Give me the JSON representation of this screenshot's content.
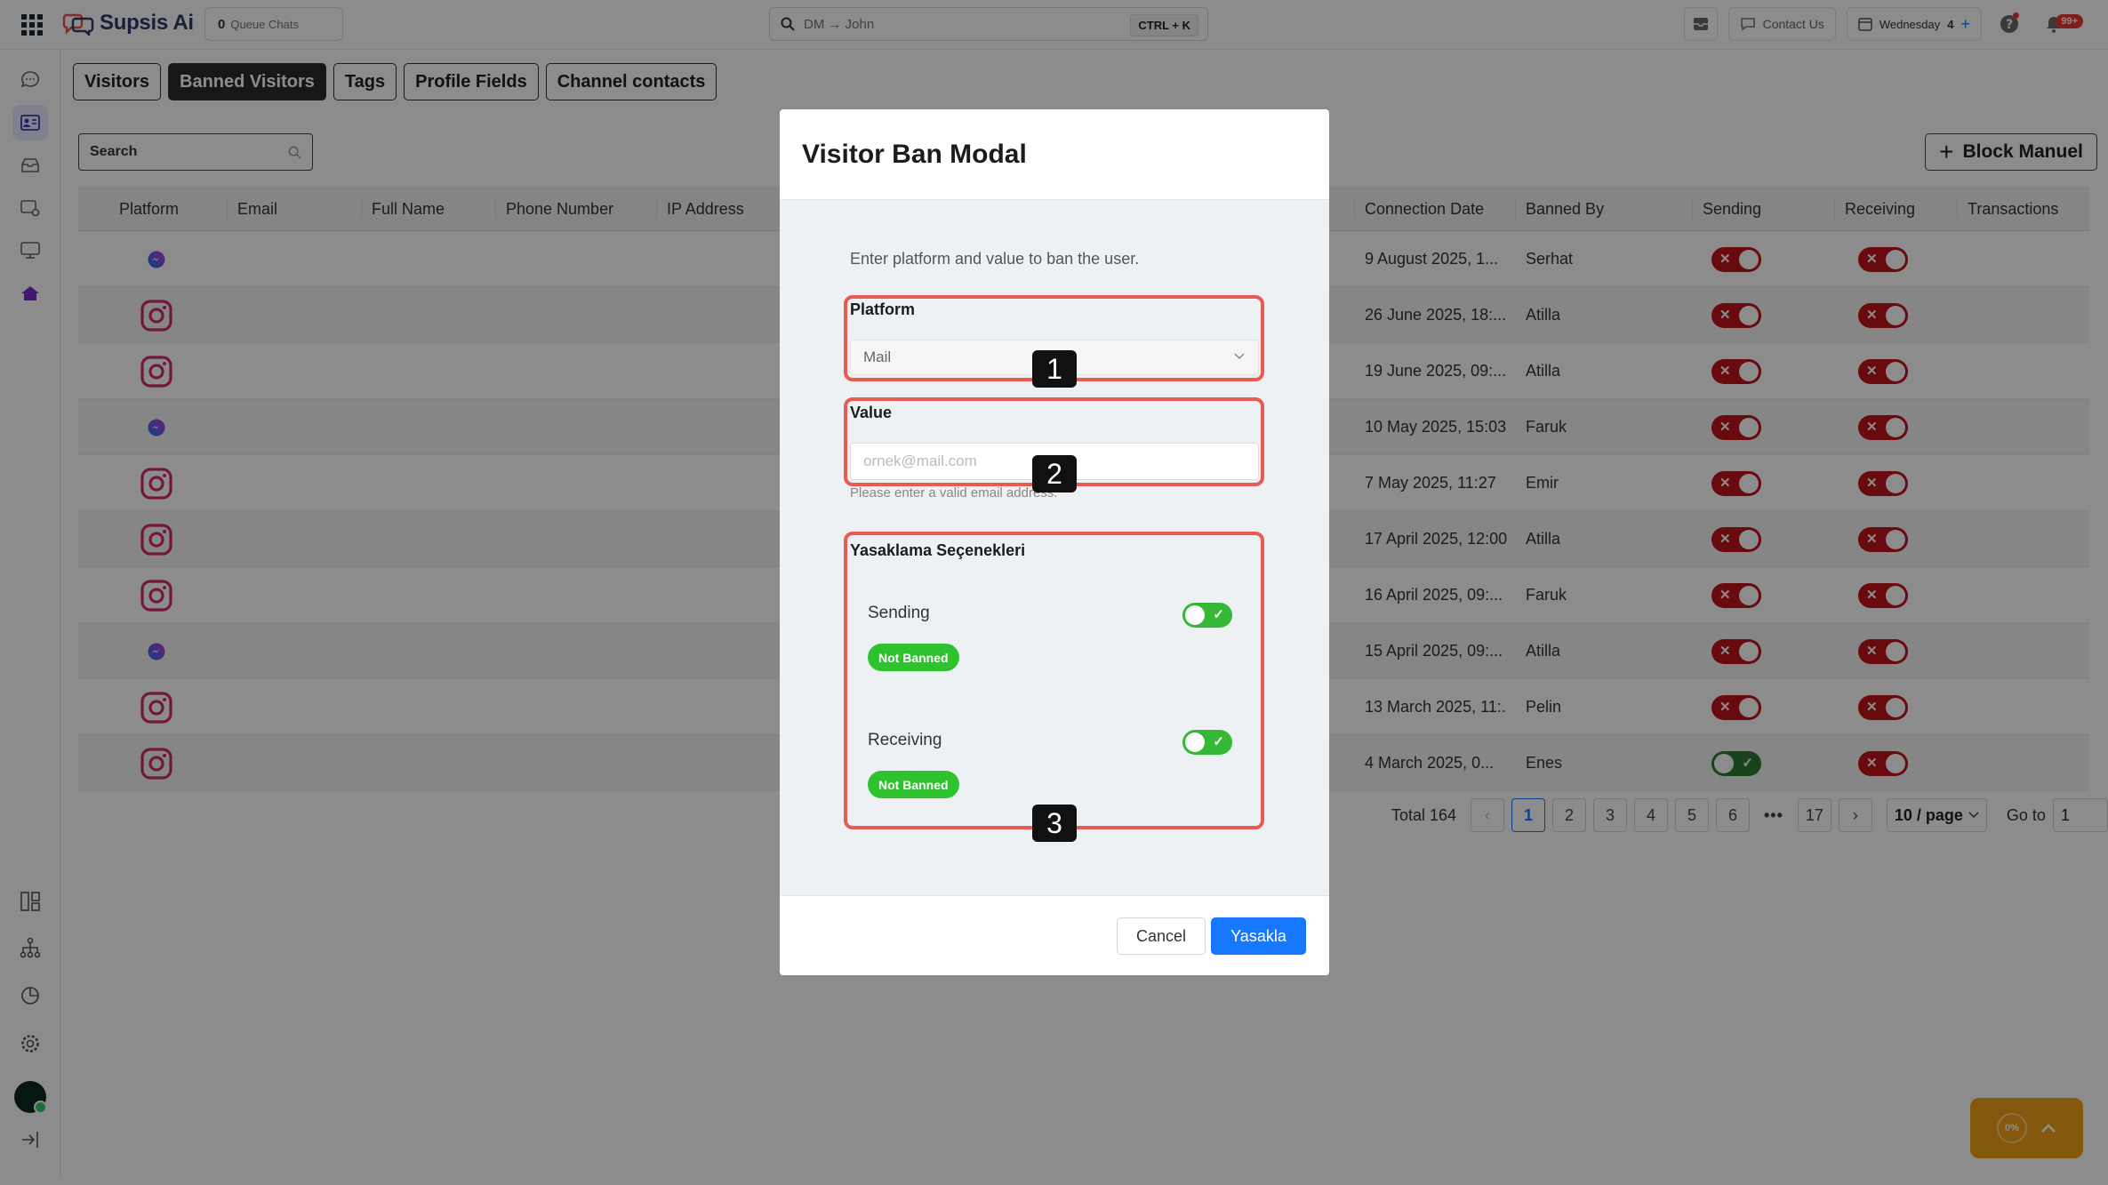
{
  "app": {
    "brand": "Supsis Ai",
    "queue": {
      "count": "0",
      "label": "Queue Chats"
    },
    "search": {
      "value": "DM → John",
      "shortcut": "CTRL + K"
    },
    "contact_us": "Contact Us",
    "day": {
      "label": "Wednesday",
      "count": "4"
    },
    "notifications_badge": "99+"
  },
  "tabs": [
    "Visitors",
    "Banned Visitors",
    "Tags",
    "Profile Fields",
    "Channel contacts"
  ],
  "table_search_label": "Search",
  "block_button_label": "Block Manuel",
  "columns": {
    "platform": "Platform",
    "email": "Email",
    "full_name": "Full Name",
    "phone": "Phone Number",
    "ip": "IP Address",
    "connection_date": "Connection Date",
    "banned_by": "Banned By",
    "sending": "Sending",
    "receiving": "Receiving",
    "transactions": "Transactions"
  },
  "rows": [
    {
      "platform": "messenger",
      "date": "9 August 2025, 1...",
      "by": "Serhat",
      "sending": "banned",
      "receiving": "banned"
    },
    {
      "platform": "instagram",
      "date": "26 June 2025, 18:...",
      "by": "Atilla",
      "sending": "banned",
      "receiving": "banned"
    },
    {
      "platform": "instagram",
      "date": "19 June 2025, 09:...",
      "by": "Atilla",
      "sending": "banned",
      "receiving": "banned"
    },
    {
      "platform": "messenger",
      "date": "10 May 2025, 15:03",
      "by": "Faruk",
      "sending": "banned",
      "receiving": "banned"
    },
    {
      "platform": "instagram",
      "date": "7 May 2025, 11:27",
      "by": "Emir",
      "sending": "banned",
      "receiving": "banned"
    },
    {
      "platform": "instagram",
      "date": "17 April 2025, 12:00",
      "by": "Atilla",
      "sending": "banned",
      "receiving": "banned"
    },
    {
      "platform": "instagram",
      "date": "16 April 2025, 09:...",
      "by": "Faruk",
      "sending": "banned",
      "receiving": "banned"
    },
    {
      "platform": "messenger",
      "date": "15 April 2025, 09:...",
      "by": "Atilla",
      "sending": "banned",
      "receiving": "banned"
    },
    {
      "platform": "instagram",
      "date": "13 March 2025, 11:...",
      "by": "Pelin",
      "sending": "banned",
      "receiving": "banned"
    },
    {
      "platform": "instagram",
      "date": "4 March 2025, 0...",
      "by": "Enes",
      "sending": "allowed",
      "receiving": "banned"
    }
  ],
  "pagination": {
    "total": "Total 164",
    "pages": [
      "1",
      "2",
      "3",
      "4",
      "5",
      "6",
      "•••",
      "17"
    ],
    "page_size": "10 / page",
    "goto_label": "Go to",
    "goto_value": "1"
  },
  "widget_percent": "0%",
  "modal": {
    "title": "Visitor Ban Modal",
    "intro": "Enter platform and value to ban the user.",
    "platform_label": "Platform",
    "platform_value": "Mail",
    "value_label": "Value",
    "value_placeholder": "ornek@mail.com",
    "help": "Please enter a valid email address.",
    "options_label": "Yasaklama Seçenekleri",
    "sending_label": "Sending",
    "receiving_label": "Receiving",
    "status": "Not Banned",
    "cancel": "Cancel",
    "submit": "Yasakla",
    "markers": [
      "1",
      "2",
      "3"
    ]
  },
  "colors": {
    "banned": "#c0131b",
    "allowed": "#2e7d32",
    "primary": "#1677ff",
    "highlight": "#e85a52",
    "badge_green": "#2ec22e"
  }
}
